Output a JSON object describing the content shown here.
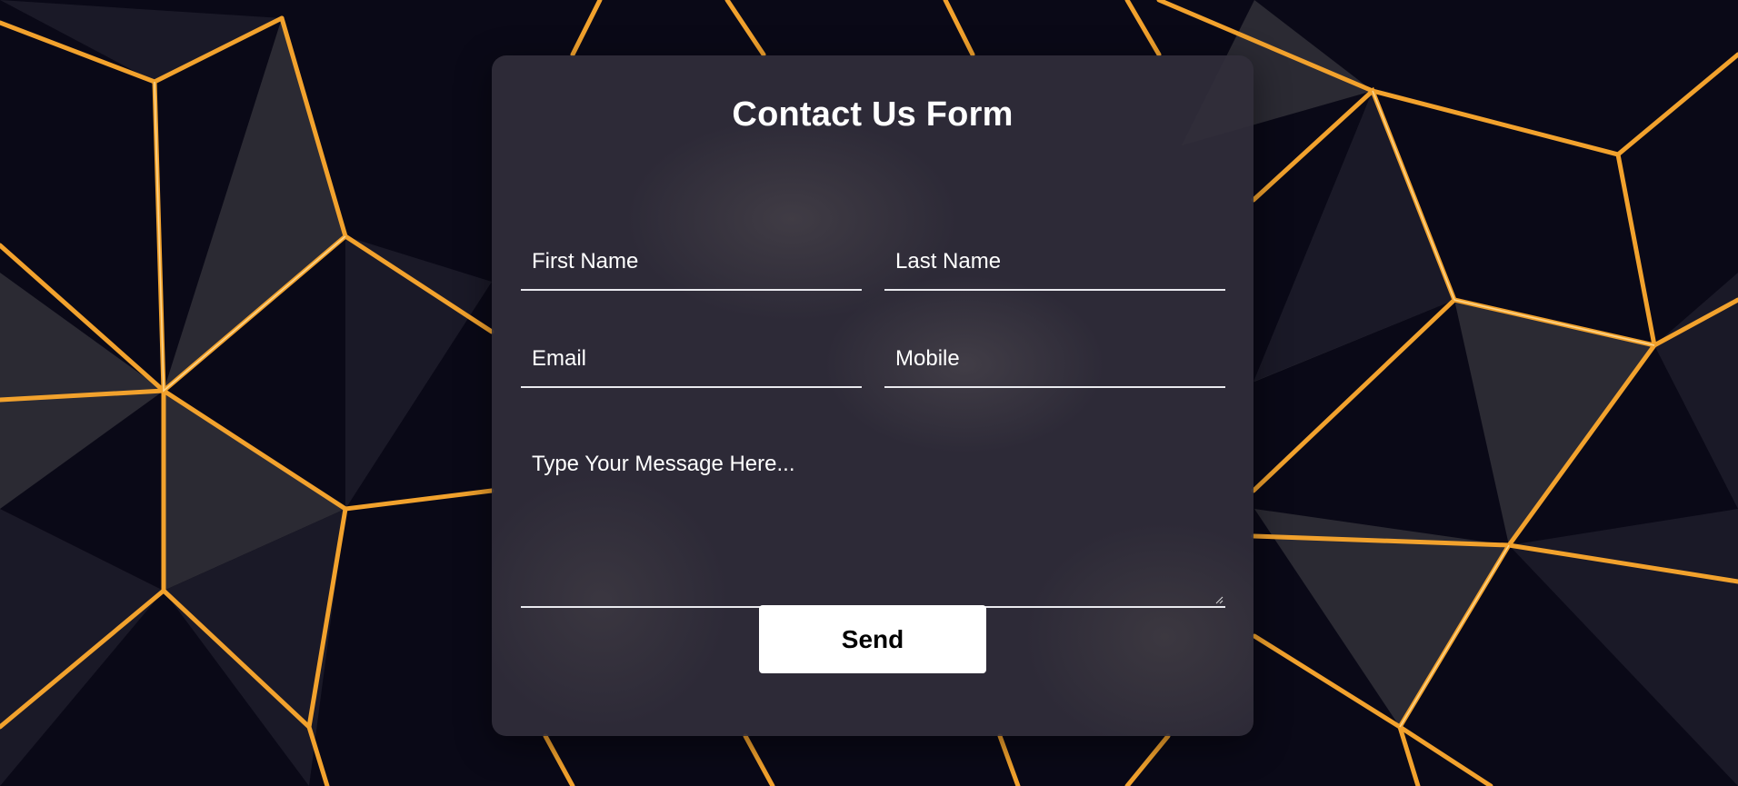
{
  "form": {
    "title": "Contact Us Form",
    "first_name_placeholder": "First Name",
    "last_name_placeholder": "Last Name",
    "email_placeholder": "Email",
    "mobile_placeholder": "Mobile",
    "message_placeholder": "Type Your Message Here...",
    "send_label": "Send"
  },
  "colors": {
    "background": "#0b0a18",
    "accent": "#f0a12a",
    "card": "#302d3a",
    "text": "#ffffff",
    "button_bg": "#ffffff",
    "button_text": "#000000"
  }
}
